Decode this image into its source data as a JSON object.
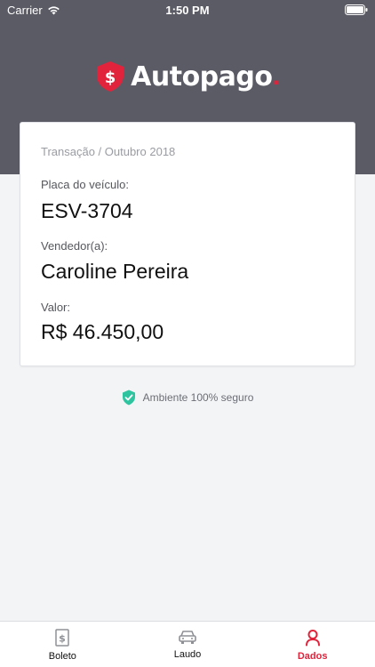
{
  "status_bar": {
    "carrier": "Carrier",
    "time": "1:50 PM"
  },
  "brand": {
    "name": "Autopago",
    "dot": ".",
    "accent_color": "#e1233b"
  },
  "card": {
    "subtitle": "Transação / Outubro 2018",
    "fields": [
      {
        "label": "Placa do veículo:",
        "value": "ESV-3704"
      },
      {
        "label": "Vendedor(a):",
        "value": "Caroline Pereira"
      },
      {
        "label": "Valor:",
        "value": "R$ 46.450,00"
      }
    ]
  },
  "secure_badge": {
    "text": "Ambiente 100% seguro",
    "icon": "shield-check-icon",
    "color": "#2ec4a0"
  },
  "tabs": [
    {
      "label": "Boleto",
      "icon": "boleto-icon",
      "active": false
    },
    {
      "label": "Laudo",
      "icon": "car-icon",
      "active": false
    },
    {
      "label": "Dados",
      "icon": "user-icon",
      "active": true
    }
  ]
}
